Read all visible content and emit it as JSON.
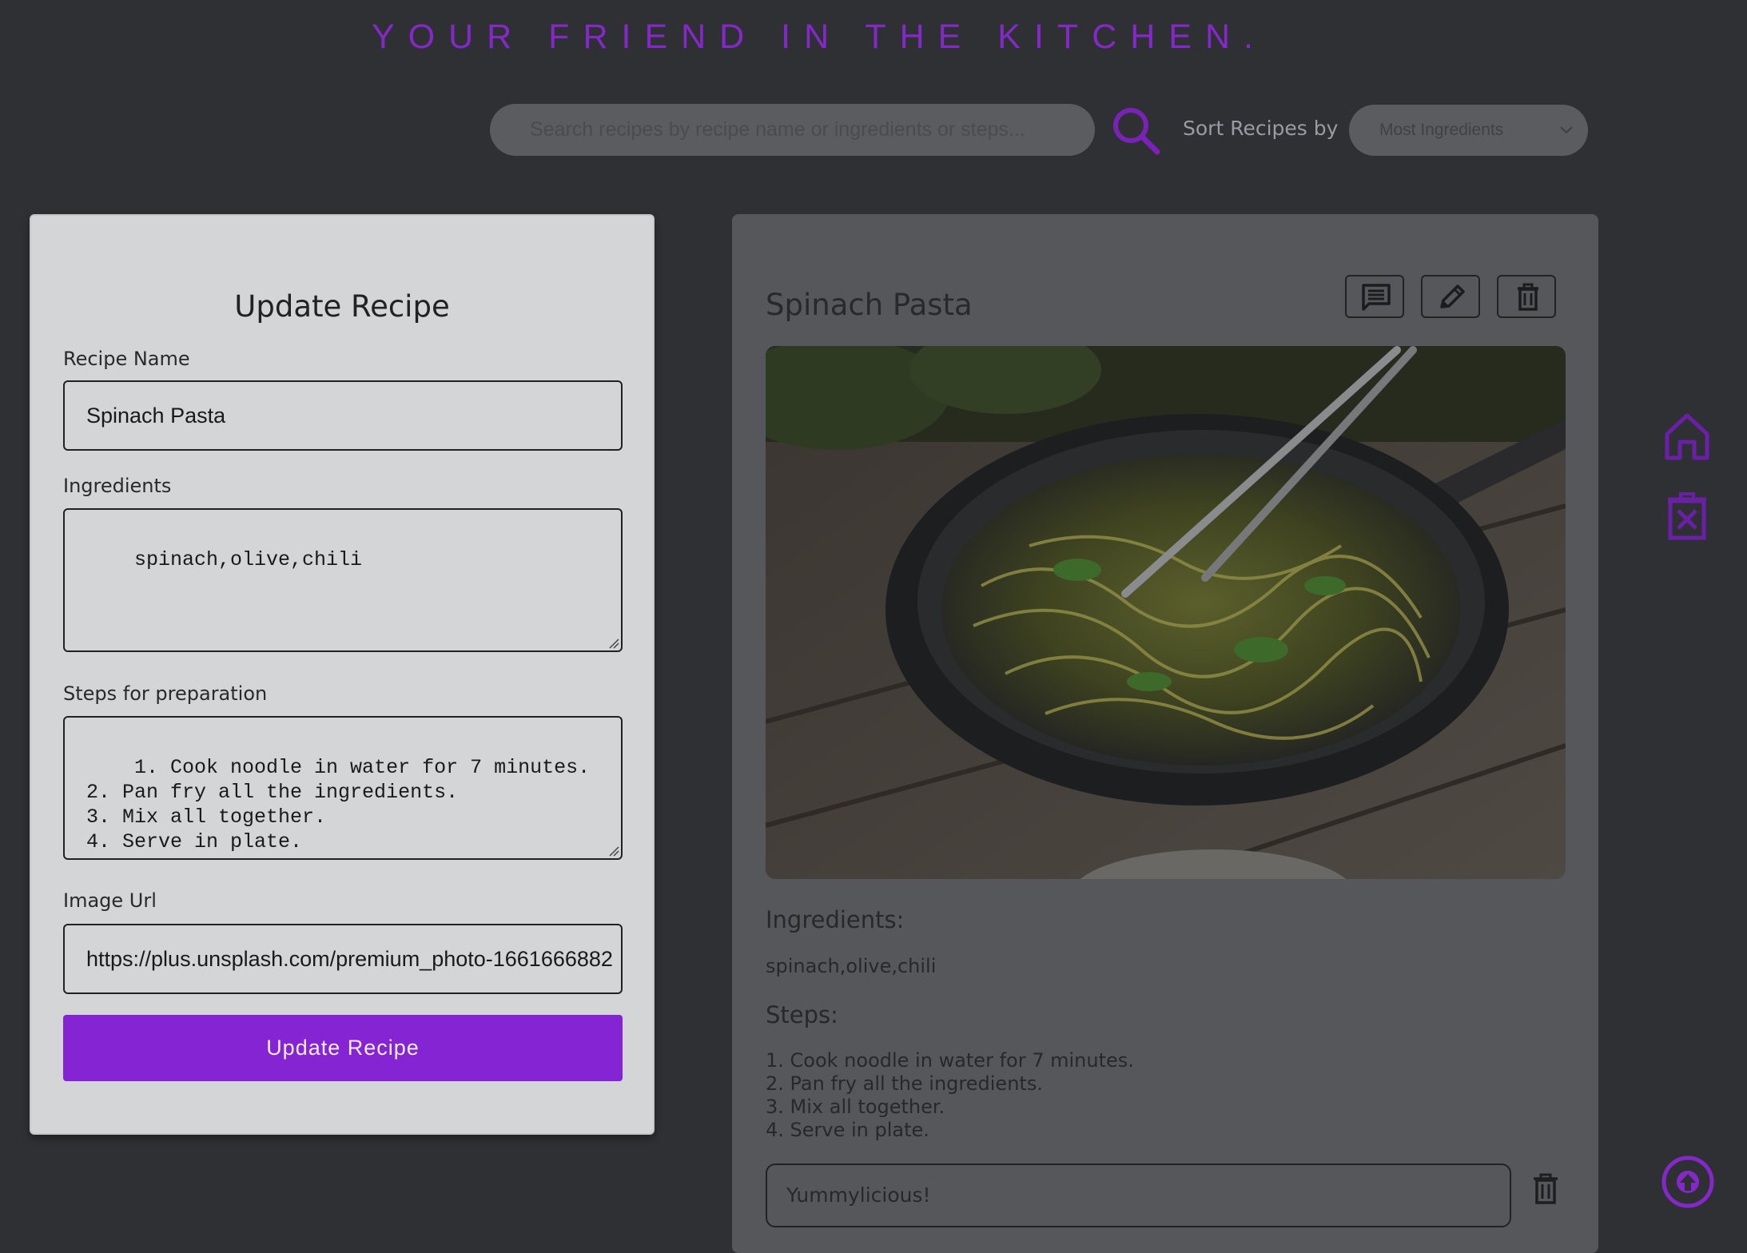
{
  "header": {
    "tagline": "YOUR FRIEND IN THE KITCHEN.",
    "search_placeholder": "Search recipes by recipe name or ingredients or steps...",
    "sort_label": "Sort Recipes by",
    "sort_selected": "Most Ingredients",
    "accent_color": "#8428c9"
  },
  "form": {
    "title": "Update Recipe",
    "recipe_name_label": "Recipe Name",
    "recipe_name_value": "Spinach Pasta",
    "ingredients_label": "Ingredients",
    "ingredients_value": "spinach,olive,chili",
    "steps_label": "Steps for preparation",
    "steps_value": "1. Cook noodle in water for 7 minutes.\n2. Pan fry all the ingredients.\n3. Mix all together.\n4. Serve in plate.",
    "image_url_label": "Image Url",
    "image_url_value": "https://plus.unsplash.com/premium_photo-1661666882",
    "submit_label": "Update Recipe"
  },
  "recipe": {
    "title": "Spinach Pasta",
    "actions": [
      "comment-icon",
      "edit-icon",
      "trash-icon"
    ],
    "ingredients_heading": "Ingredients:",
    "ingredients": "spinach,olive,chili",
    "steps_heading": "Steps:",
    "steps": [
      "1. Cook noodle in water for 7 minutes.",
      "2. Pan fry all the ingredients.",
      "3. Mix all together.",
      "4. Serve in plate."
    ],
    "comment": "Yummylicious!"
  },
  "side_nav": [
    "home-icon",
    "clear-icon",
    "scroll-top-icon"
  ]
}
